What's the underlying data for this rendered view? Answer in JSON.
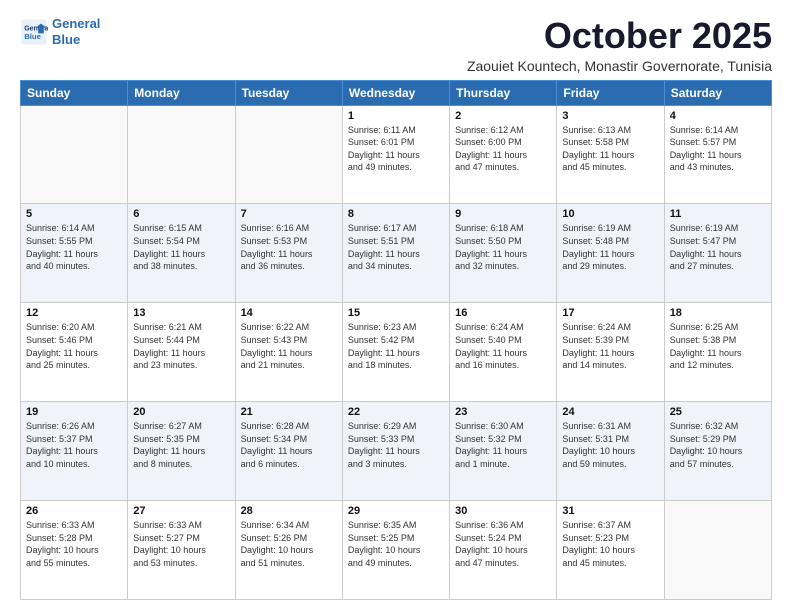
{
  "logo": {
    "line1": "General",
    "line2": "Blue"
  },
  "title": "October 2025",
  "location": "Zaouiet Kountech, Monastir Governorate, Tunisia",
  "weekdays": [
    "Sunday",
    "Monday",
    "Tuesday",
    "Wednesday",
    "Thursday",
    "Friday",
    "Saturday"
  ],
  "weeks": [
    [
      {
        "day": "",
        "info": ""
      },
      {
        "day": "",
        "info": ""
      },
      {
        "day": "",
        "info": ""
      },
      {
        "day": "1",
        "info": "Sunrise: 6:11 AM\nSunset: 6:01 PM\nDaylight: 11 hours\nand 49 minutes."
      },
      {
        "day": "2",
        "info": "Sunrise: 6:12 AM\nSunset: 6:00 PM\nDaylight: 11 hours\nand 47 minutes."
      },
      {
        "day": "3",
        "info": "Sunrise: 6:13 AM\nSunset: 5:58 PM\nDaylight: 11 hours\nand 45 minutes."
      },
      {
        "day": "4",
        "info": "Sunrise: 6:14 AM\nSunset: 5:57 PM\nDaylight: 11 hours\nand 43 minutes."
      }
    ],
    [
      {
        "day": "5",
        "info": "Sunrise: 6:14 AM\nSunset: 5:55 PM\nDaylight: 11 hours\nand 40 minutes."
      },
      {
        "day": "6",
        "info": "Sunrise: 6:15 AM\nSunset: 5:54 PM\nDaylight: 11 hours\nand 38 minutes."
      },
      {
        "day": "7",
        "info": "Sunrise: 6:16 AM\nSunset: 5:53 PM\nDaylight: 11 hours\nand 36 minutes."
      },
      {
        "day": "8",
        "info": "Sunrise: 6:17 AM\nSunset: 5:51 PM\nDaylight: 11 hours\nand 34 minutes."
      },
      {
        "day": "9",
        "info": "Sunrise: 6:18 AM\nSunset: 5:50 PM\nDaylight: 11 hours\nand 32 minutes."
      },
      {
        "day": "10",
        "info": "Sunrise: 6:19 AM\nSunset: 5:48 PM\nDaylight: 11 hours\nand 29 minutes."
      },
      {
        "day": "11",
        "info": "Sunrise: 6:19 AM\nSunset: 5:47 PM\nDaylight: 11 hours\nand 27 minutes."
      }
    ],
    [
      {
        "day": "12",
        "info": "Sunrise: 6:20 AM\nSunset: 5:46 PM\nDaylight: 11 hours\nand 25 minutes."
      },
      {
        "day": "13",
        "info": "Sunrise: 6:21 AM\nSunset: 5:44 PM\nDaylight: 11 hours\nand 23 minutes."
      },
      {
        "day": "14",
        "info": "Sunrise: 6:22 AM\nSunset: 5:43 PM\nDaylight: 11 hours\nand 21 minutes."
      },
      {
        "day": "15",
        "info": "Sunrise: 6:23 AM\nSunset: 5:42 PM\nDaylight: 11 hours\nand 18 minutes."
      },
      {
        "day": "16",
        "info": "Sunrise: 6:24 AM\nSunset: 5:40 PM\nDaylight: 11 hours\nand 16 minutes."
      },
      {
        "day": "17",
        "info": "Sunrise: 6:24 AM\nSunset: 5:39 PM\nDaylight: 11 hours\nand 14 minutes."
      },
      {
        "day": "18",
        "info": "Sunrise: 6:25 AM\nSunset: 5:38 PM\nDaylight: 11 hours\nand 12 minutes."
      }
    ],
    [
      {
        "day": "19",
        "info": "Sunrise: 6:26 AM\nSunset: 5:37 PM\nDaylight: 11 hours\nand 10 minutes."
      },
      {
        "day": "20",
        "info": "Sunrise: 6:27 AM\nSunset: 5:35 PM\nDaylight: 11 hours\nand 8 minutes."
      },
      {
        "day": "21",
        "info": "Sunrise: 6:28 AM\nSunset: 5:34 PM\nDaylight: 11 hours\nand 6 minutes."
      },
      {
        "day": "22",
        "info": "Sunrise: 6:29 AM\nSunset: 5:33 PM\nDaylight: 11 hours\nand 3 minutes."
      },
      {
        "day": "23",
        "info": "Sunrise: 6:30 AM\nSunset: 5:32 PM\nDaylight: 11 hours\nand 1 minute."
      },
      {
        "day": "24",
        "info": "Sunrise: 6:31 AM\nSunset: 5:31 PM\nDaylight: 10 hours\nand 59 minutes."
      },
      {
        "day": "25",
        "info": "Sunrise: 6:32 AM\nSunset: 5:29 PM\nDaylight: 10 hours\nand 57 minutes."
      }
    ],
    [
      {
        "day": "26",
        "info": "Sunrise: 6:33 AM\nSunset: 5:28 PM\nDaylight: 10 hours\nand 55 minutes."
      },
      {
        "day": "27",
        "info": "Sunrise: 6:33 AM\nSunset: 5:27 PM\nDaylight: 10 hours\nand 53 minutes."
      },
      {
        "day": "28",
        "info": "Sunrise: 6:34 AM\nSunset: 5:26 PM\nDaylight: 10 hours\nand 51 minutes."
      },
      {
        "day": "29",
        "info": "Sunrise: 6:35 AM\nSunset: 5:25 PM\nDaylight: 10 hours\nand 49 minutes."
      },
      {
        "day": "30",
        "info": "Sunrise: 6:36 AM\nSunset: 5:24 PM\nDaylight: 10 hours\nand 47 minutes."
      },
      {
        "day": "31",
        "info": "Sunrise: 6:37 AM\nSunset: 5:23 PM\nDaylight: 10 hours\nand 45 minutes."
      },
      {
        "day": "",
        "info": ""
      }
    ]
  ]
}
